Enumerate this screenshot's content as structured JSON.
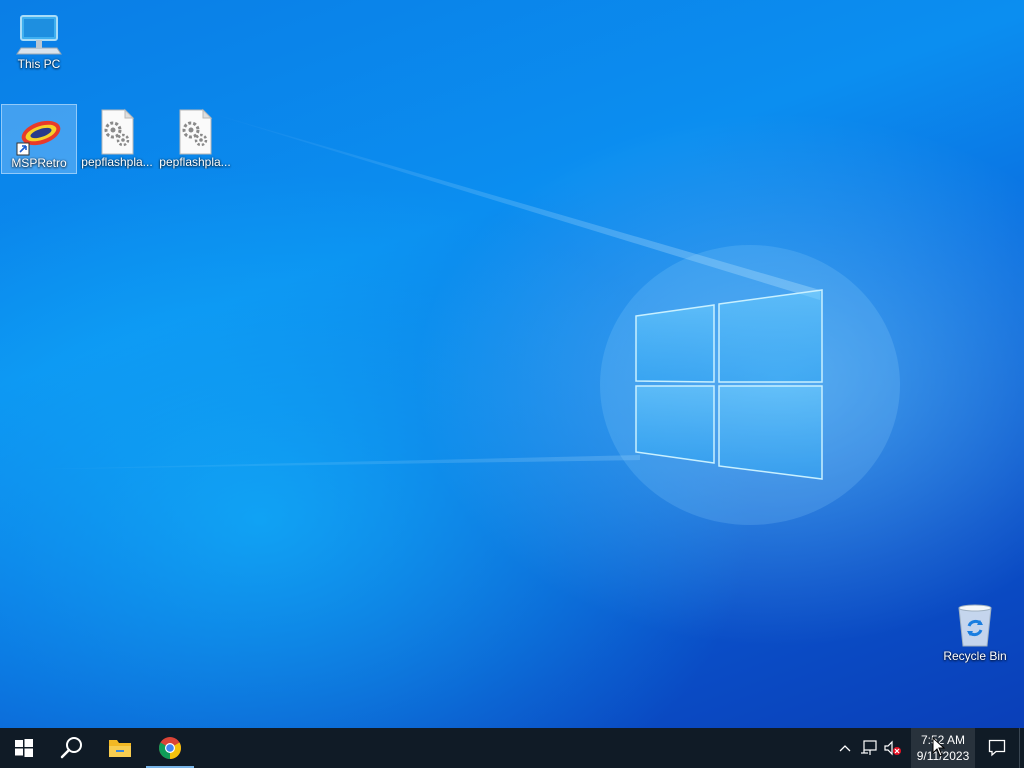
{
  "desktop": {
    "icons": [
      {
        "label": "This PC",
        "icon": "computer-icon"
      },
      {
        "label": "MSPRetro",
        "icon": "msp-retro-shortcut-icon",
        "selected": true
      },
      {
        "label": "pepflashpla...",
        "icon": "settings-file-icon"
      },
      {
        "label": "pepflashpla...",
        "icon": "settings-file-icon"
      },
      {
        "label": "Recycle Bin",
        "icon": "recycle-bin-icon"
      }
    ]
  },
  "taskbar": {
    "start": {
      "icon": "windows-logo-icon"
    },
    "search": {
      "icon": "search-icon"
    },
    "apps": [
      {
        "name": "File Explorer",
        "icon": "folder-icon",
        "running": false
      },
      {
        "name": "Google Chrome",
        "icon": "chrome-icon",
        "running": true
      }
    ],
    "tray": {
      "icons": [
        "chevron-up-icon",
        "network-icon",
        "volume-muted-icon"
      ],
      "time": "7:52 AM",
      "date": "9/11/2023",
      "notification_icon": "action-center-icon"
    }
  },
  "colors": {
    "taskbar_bg": "#101b26",
    "accent": "#0a78e0",
    "running_indicator": "#78b4e8"
  }
}
